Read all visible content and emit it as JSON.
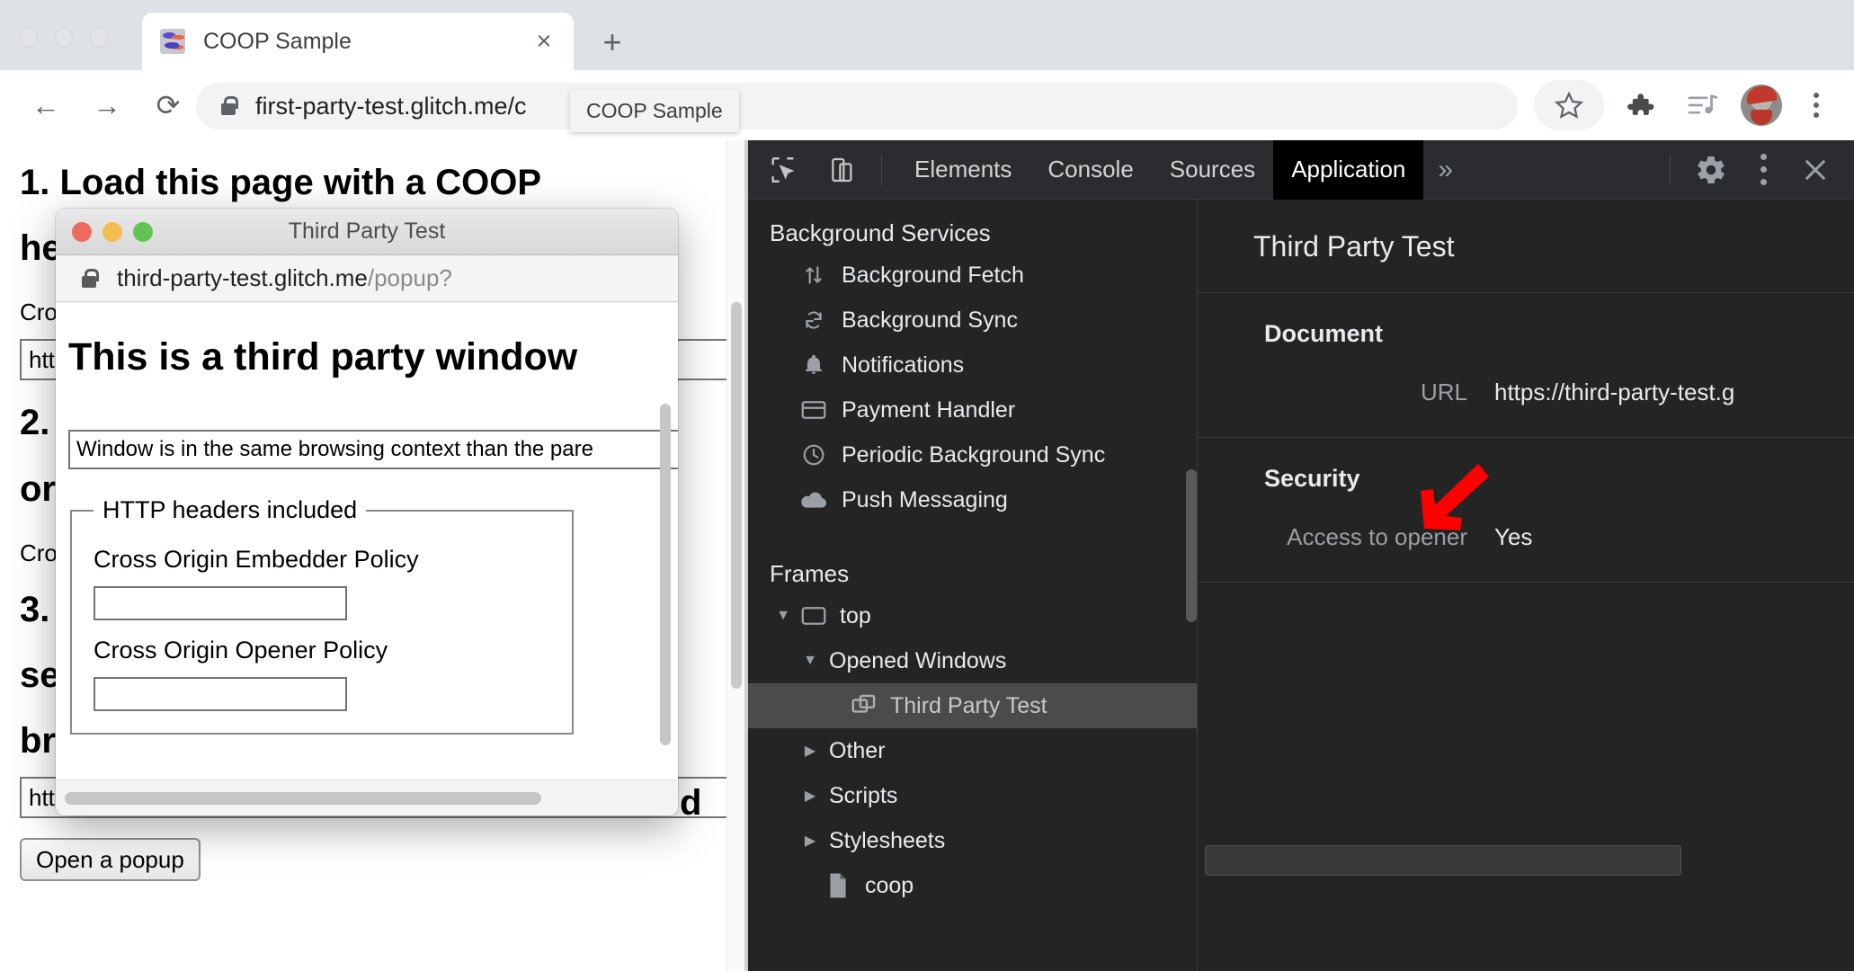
{
  "browser": {
    "tab": {
      "title": "COOP Sample",
      "close_label": "×",
      "favicon": "glitch-fish-favicon"
    },
    "new_tab_label": "+",
    "nav": {
      "back": "←",
      "forward": "→",
      "reload": "⟳"
    },
    "omnibox": {
      "url": "first-party-test.glitch.me/c",
      "lock": "lock-icon"
    },
    "tab_tooltip": "COOP Sample",
    "toolbar_icons": [
      "bookmark-star-icon",
      "extensions-puzzle-icon",
      "media-controls-icon",
      "profile-avatar",
      "chrome-menu-kebab"
    ]
  },
  "page": {
    "heading_1": "1. Load this page with a COOP",
    "heading_1_line2": "he",
    "text_1": "Cro",
    "input_1_value": "http",
    "heading_2_line1": "2.",
    "heading_2_line2": "or",
    "text_2": "Cro",
    "heading_3_line1": "3.",
    "heading_3_line2": "se",
    "heading_3_line3": "br",
    "fragment_right": "d",
    "popup_url_value": "https://third-party-test.glitch.me/popup?",
    "open_popup_button": "Open a popup"
  },
  "popup_window": {
    "title": "Third Party Test",
    "traffic_lights": [
      "close-red",
      "minimize-yellow",
      "zoom-green"
    ],
    "url_main": "third-party-test.glitch.me",
    "url_path": "/popup?",
    "heading": "This is a third party window",
    "status_text": "Window is in the same browsing context than the pare",
    "fieldset_legend": "HTTP headers included",
    "fields": [
      {
        "label": "Cross Origin Embedder Policy",
        "value": ""
      },
      {
        "label": "Cross Origin Opener Policy",
        "value": ""
      }
    ]
  },
  "devtools": {
    "toolbar": {
      "inspect_icon": "inspect-element-icon",
      "device_icon": "device-toolbar-icon",
      "tabs": [
        {
          "label": "Elements",
          "active": false
        },
        {
          "label": "Console",
          "active": false
        },
        {
          "label": "Sources",
          "active": false
        },
        {
          "label": "Application",
          "active": true
        }
      ],
      "more_tabs": "»",
      "settings_icon": "gear-icon",
      "menu_icon": "kebab-menu-icon",
      "close_icon": "close-icon"
    },
    "sidebar": {
      "background_services_title": "Background Services",
      "background_services": [
        {
          "label": "Background Fetch",
          "icon": "arrows-up-down-icon"
        },
        {
          "label": "Background Sync",
          "icon": "sync-icon"
        },
        {
          "label": "Notifications",
          "icon": "bell-icon"
        },
        {
          "label": "Payment Handler",
          "icon": "credit-card-icon"
        },
        {
          "label": "Periodic Background Sync",
          "icon": "clock-icon"
        },
        {
          "label": "Push Messaging",
          "icon": "cloud-icon"
        }
      ],
      "frames_title": "Frames",
      "frames": [
        {
          "label": "top",
          "icon": "frame-icon",
          "arrow": "▼",
          "indent": 26,
          "selected": false
        },
        {
          "label": "Opened Windows",
          "icon": "",
          "arrow": "▼",
          "indent": 56,
          "selected": false
        },
        {
          "label": "Third Party Test",
          "icon": "window-icon",
          "arrow": "",
          "indent": 112,
          "selected": true
        },
        {
          "label": "Other",
          "icon": "",
          "arrow": "▶",
          "indent": 56,
          "selected": false
        },
        {
          "label": "Scripts",
          "icon": "",
          "arrow": "▶",
          "indent": 56,
          "selected": false
        },
        {
          "label": "Stylesheets",
          "icon": "",
          "arrow": "▶",
          "indent": 56,
          "selected": false
        },
        {
          "label": "coop",
          "icon": "document-icon",
          "arrow": "",
          "indent": 82,
          "selected": false
        }
      ]
    },
    "detail": {
      "header": "Third Party Test",
      "document_group_title": "Document",
      "document_rows": [
        {
          "key": "URL",
          "value": "https://third-party-test.g"
        }
      ],
      "security_group_title": "Security",
      "security_rows": [
        {
          "key": "Access to opener",
          "value": "Yes"
        }
      ]
    }
  },
  "annotation": {
    "arrow_color": "#ff0000",
    "arrow_direction": "down-left",
    "points_at": "Security"
  }
}
